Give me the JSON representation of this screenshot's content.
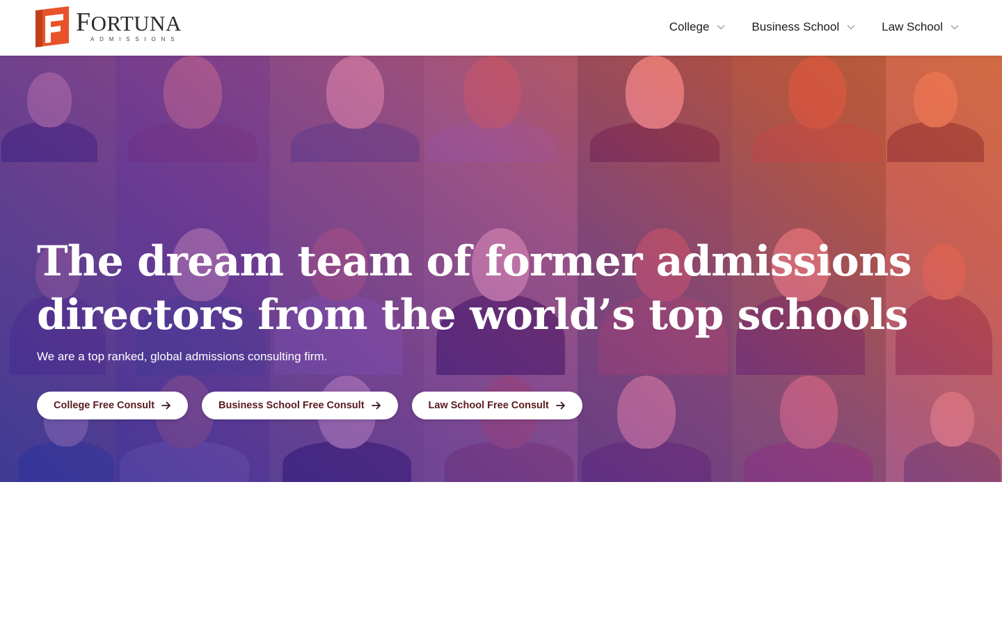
{
  "brand": {
    "name_big_f": "F",
    "name_rest": "ORTUNA",
    "tagline": "ADMISSIONS",
    "logo_color": "#e8532a"
  },
  "nav": {
    "items": [
      {
        "label": "College",
        "icon": "chevron-down-icon"
      },
      {
        "label": "Business School",
        "icon": "chevron-down-icon"
      },
      {
        "label": "Law School",
        "icon": "chevron-down-icon"
      }
    ]
  },
  "hero": {
    "title_line1": "The dream team of former admissions",
    "title_line2": "directors from the world’s top schools",
    "subtitle": "We are a top ranked, global admissions consulting firm.",
    "buttons": [
      {
        "label": "College Free Consult",
        "icon": "arrow-right-icon"
      },
      {
        "label": "Business School Free Consult",
        "icon": "arrow-right-icon"
      },
      {
        "label": "Law School Free Consult",
        "icon": "arrow-right-icon"
      }
    ],
    "gradient_colors": [
      "#2f2f9e",
      "#8a2db0",
      "#e55a3a"
    ],
    "button_text_color": "#5a1a1f"
  }
}
